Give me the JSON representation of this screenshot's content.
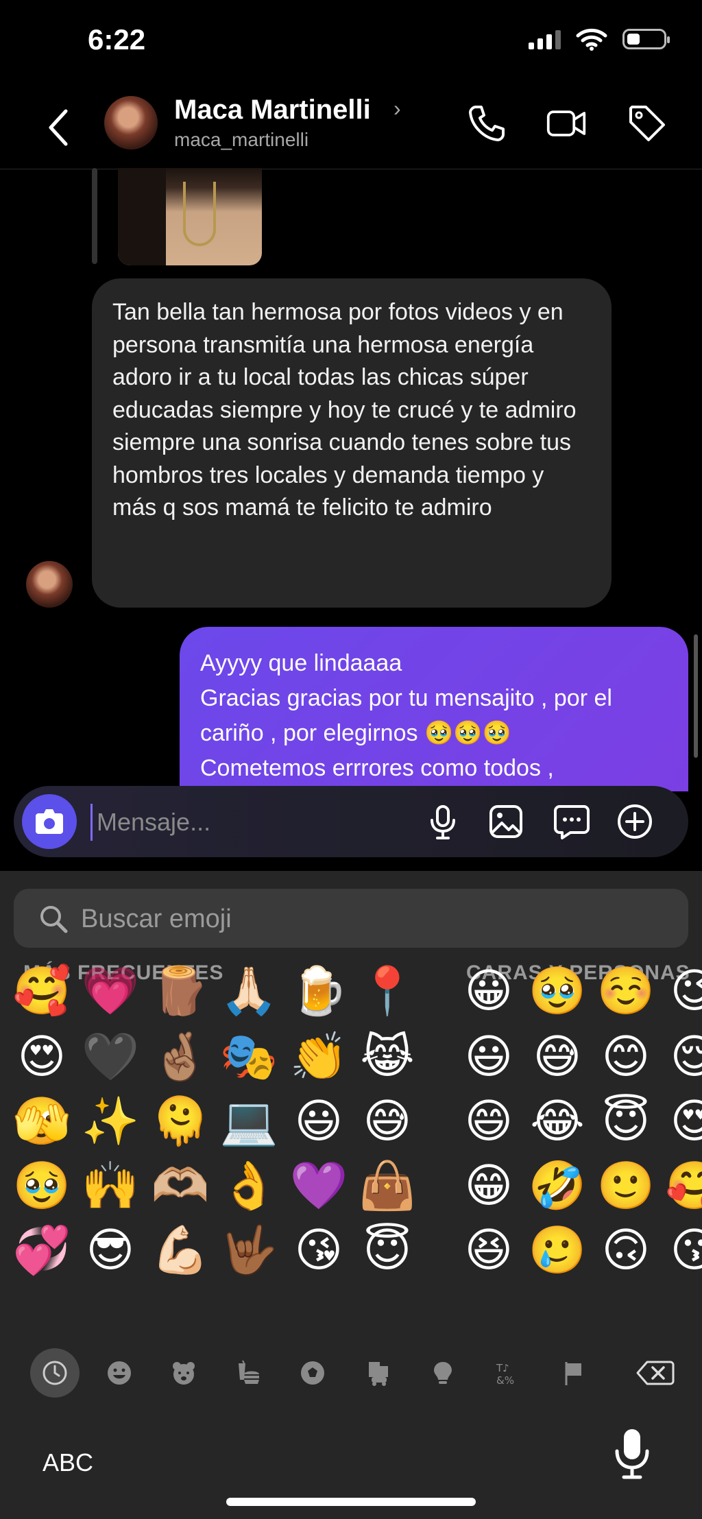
{
  "status": {
    "time": "6:22"
  },
  "header": {
    "name": "Maca Martinelli",
    "handle": "maca_martinelli",
    "chevron": "›"
  },
  "messages": {
    "incoming": "Tan bella tan hermosa por fotos videos y en persona transmitía una hermosa energía adoro ir a tu local todas las chicas súper educadas siempre y hoy te crucé y te admiro siempre una sonrisa  cuando tenes sobre tus hombros tres locales y demanda tiempo y más q sos mamá te felicito te admiro",
    "outgoing_lines": [
      "Ayyyy que lindaaaa",
      "Gracias gracias por tu mensajito , por el cariño , por elegirnos 🥹🥹🥹",
      "Cometemos errrores como todos ,"
    ]
  },
  "composer": {
    "placeholder": "Mensaje..."
  },
  "keyboard": {
    "search_placeholder": "Buscar emoji",
    "frequent_label": "MÁS FRECUENTES",
    "faces_label": "CARAS Y PERSONAS",
    "abc_label": "ABC",
    "frequent_emojis": [
      [
        "🥰",
        "💗",
        "🪵",
        "🙏🏻",
        "🍺",
        "📍"
      ],
      [
        "😍",
        "🖤",
        "🤞🏽",
        "🎭",
        "👏",
        "😹"
      ],
      [
        "🫣",
        "✨",
        "🫠",
        "💻",
        "😃",
        "😅"
      ],
      [
        "🥹",
        "🙌",
        "🫶🏼",
        "👌",
        "💜",
        "👜"
      ],
      [
        "💞",
        "😎",
        "💪🏻",
        "🤟🏾",
        "😘",
        "😇"
      ]
    ],
    "face_emojis": [
      [
        "😀",
        "🥹",
        "☺️",
        "😉"
      ],
      [
        "😃",
        "😅",
        "😊",
        "😌"
      ],
      [
        "😄",
        "😂",
        "😇",
        "😍"
      ],
      [
        "😁",
        "🤣",
        "🙂",
        "🥰"
      ],
      [
        "😆",
        "🥲",
        "🙃",
        "😗"
      ]
    ]
  }
}
